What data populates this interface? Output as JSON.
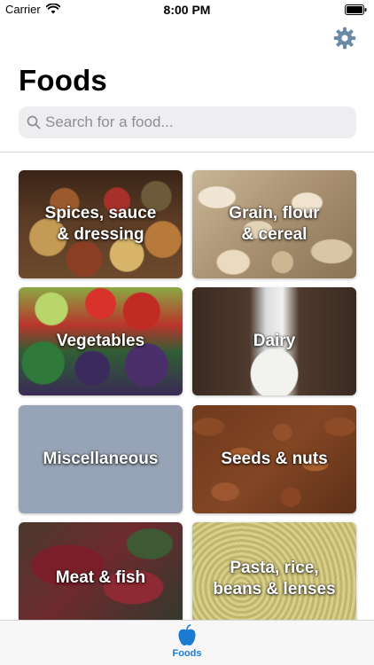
{
  "status_bar": {
    "carrier": "Carrier",
    "time": "8:00 PM"
  },
  "header": {
    "title": "Foods",
    "settings_icon": "gear-icon"
  },
  "search": {
    "placeholder": "Search for a food...",
    "value": "",
    "icon": "search-icon"
  },
  "categories": [
    {
      "name": "spices",
      "label": "Spices, sauce\n& dressing"
    },
    {
      "name": "grain",
      "label": "Grain, flour\n& cereal"
    },
    {
      "name": "vegetables",
      "label": "Vegetables"
    },
    {
      "name": "dairy",
      "label": "Dairy"
    },
    {
      "name": "miscellaneous",
      "label": "Miscellaneous"
    },
    {
      "name": "seeds",
      "label": "Seeds & nuts"
    },
    {
      "name": "meat",
      "label": "Meat & fish"
    },
    {
      "name": "pasta",
      "label": "Pasta, rice,\nbeans & lenses"
    }
  ],
  "tab_bar": {
    "tabs": [
      {
        "label": "Foods",
        "icon": "apple-icon",
        "active": true
      }
    ]
  },
  "colors": {
    "accent": "#1a7bd0",
    "settings_icon": "#6a8aa8",
    "search_bg": "#eeeef0",
    "misc_tile": "#97a3b6"
  }
}
